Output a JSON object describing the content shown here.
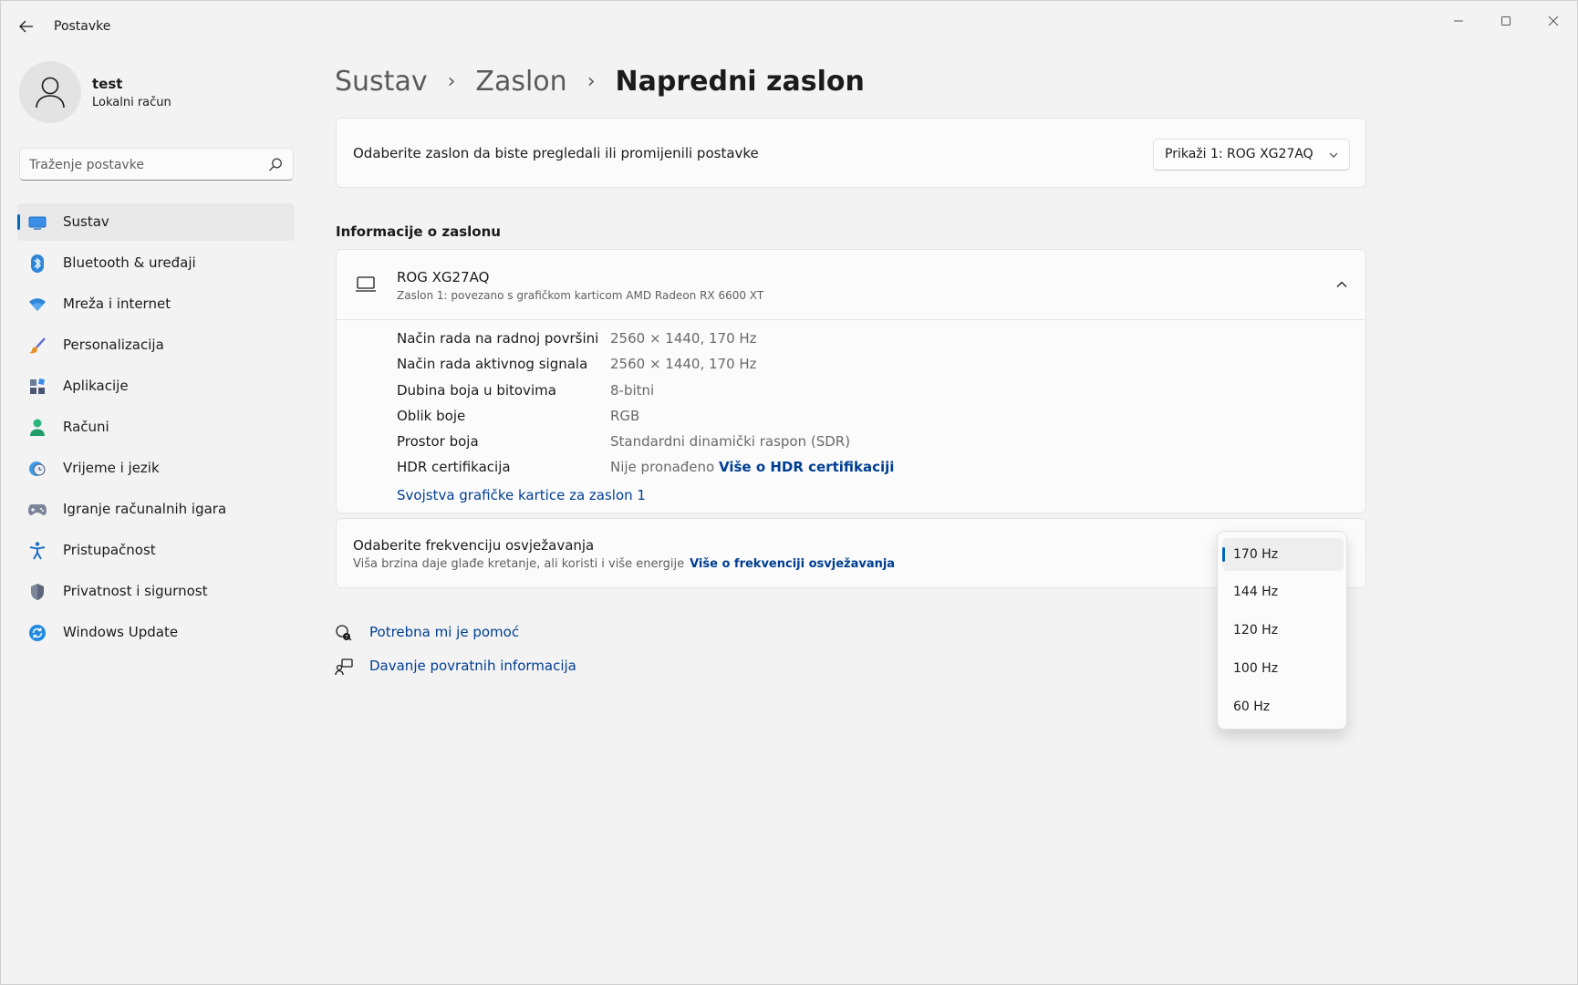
{
  "window": {
    "title": "Postavke"
  },
  "profile": {
    "name": "test",
    "account": "Lokalni račun"
  },
  "search": {
    "placeholder": "Traženje postavke"
  },
  "sidebar": {
    "items": [
      {
        "label": "Sustav",
        "icon": "system-icon",
        "active": true
      },
      {
        "label": "Bluetooth & uređaji",
        "icon": "bluetooth-icon"
      },
      {
        "label": "Mreža i internet",
        "icon": "wifi-icon"
      },
      {
        "label": "Personalizacija",
        "icon": "brush-icon"
      },
      {
        "label": "Aplikacije",
        "icon": "apps-icon"
      },
      {
        "label": "Računi",
        "icon": "person-icon"
      },
      {
        "label": "Vrijeme i jezik",
        "icon": "globe-clock-icon"
      },
      {
        "label": "Igranje računalnih igara",
        "icon": "gamepad-icon"
      },
      {
        "label": "Pristupačnost",
        "icon": "accessibility-icon"
      },
      {
        "label": "Privatnost i sigurnost",
        "icon": "shield-icon"
      },
      {
        "label": "Windows Update",
        "icon": "update-icon"
      }
    ]
  },
  "breadcrumb": {
    "level1": "Sustav",
    "level2": "Zaslon",
    "current": "Napredni zaslon"
  },
  "display_select": {
    "label": "Odaberite zaslon da biste pregledali ili promijenili postavke",
    "value": "Prikaži 1: ROG XG27AQ"
  },
  "info_section": {
    "title": "Informacije o zaslonu"
  },
  "display_info": {
    "name": "ROG XG27AQ",
    "subtitle": "Zaslon 1: povezano s grafičkom karticom AMD Radeon RX 6600 XT",
    "rows": [
      {
        "key": "Način rada na radnoj površini",
        "value": "2560 × 1440, 170 Hz"
      },
      {
        "key": "Način rada aktivnog signala",
        "value": "2560 × 1440, 170 Hz"
      },
      {
        "key": "Dubina boja u bitovima",
        "value": "8-bitni"
      },
      {
        "key": "Oblik boje",
        "value": "RGB"
      },
      {
        "key": "Prostor boja",
        "value": "Standardni dinamički raspon (SDR)"
      },
      {
        "key": "HDR certifikacija",
        "value": "Nije pronađeno",
        "link": "Više o HDR certifikaciji"
      }
    ],
    "gpu_link": "Svojstva grafičke kartice za zaslon 1"
  },
  "refresh": {
    "title": "Odaberite frekvenciju osvježavanja",
    "subtitle": "Viša brzina daje glađe kretanje, ali koristi i više energije",
    "link": "Više o frekvenciji osvježavanja",
    "options": [
      "170 Hz",
      "144 Hz",
      "120 Hz",
      "100 Hz",
      "60 Hz"
    ],
    "selected": "170 Hz"
  },
  "help": {
    "get_help": "Potrebna mi je pomoć",
    "feedback": "Davanje povratnih informacija"
  },
  "colors": {
    "accent": "#0067c0",
    "link": "#003e92",
    "background": "#f3f3f3",
    "card": "#fbfbfb"
  }
}
